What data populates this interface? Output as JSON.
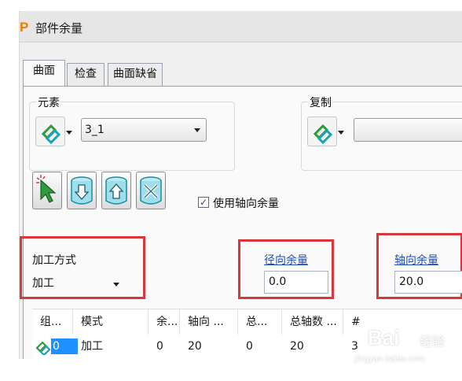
{
  "window": {
    "app_icon_letter": "P",
    "title": "部件余量"
  },
  "tabs": [
    {
      "label": "曲面",
      "active": true
    },
    {
      "label": "检查",
      "active": false
    },
    {
      "label": "曲面缺省",
      "active": false
    }
  ],
  "element_group": {
    "label": "元素",
    "icon": "surface-select-icon",
    "selected_value": "3_1"
  },
  "copy_group": {
    "label": "复制",
    "icon": "surface-select-icon",
    "selected_value": ""
  },
  "toolbar": {
    "buttons": [
      {
        "icon": "pick-cursor-icon"
      },
      {
        "icon": "cylinder-down-arrow-icon"
      },
      {
        "icon": "cylinder-up-arrow-icon"
      },
      {
        "icon": "cylinder-tools-icon"
      }
    ],
    "use_axial_allowance": {
      "label": "使用轴向余量",
      "checked": true
    }
  },
  "machining_method": {
    "label": "加工方式",
    "selected_value": "加工"
  },
  "radial_allowance": {
    "label": "径向余量",
    "value": "0.0"
  },
  "axial_allowance": {
    "label": "轴向余量",
    "value": "20.0"
  },
  "table": {
    "columns": [
      "组...",
      "模式",
      "余...",
      "轴向 ...",
      "总...",
      "总轴数 ...",
      "#"
    ],
    "rows": [
      {
        "group": "0",
        "mode": "加工",
        "allowance": "0",
        "axial": "20",
        "total": "0",
        "total_axial": "20",
        "count": "3"
      }
    ]
  },
  "watermark": {
    "logo": "Bai",
    "logo_cn": "经验",
    "url": "jingyan.baidu.com"
  },
  "colors": {
    "highlight_red": "#d8383a",
    "link_blue": "#1f4fb8",
    "selection_blue": "#1e90ff",
    "icon_green": "#2e9a3a",
    "icon_teal": "#19a3b8"
  }
}
